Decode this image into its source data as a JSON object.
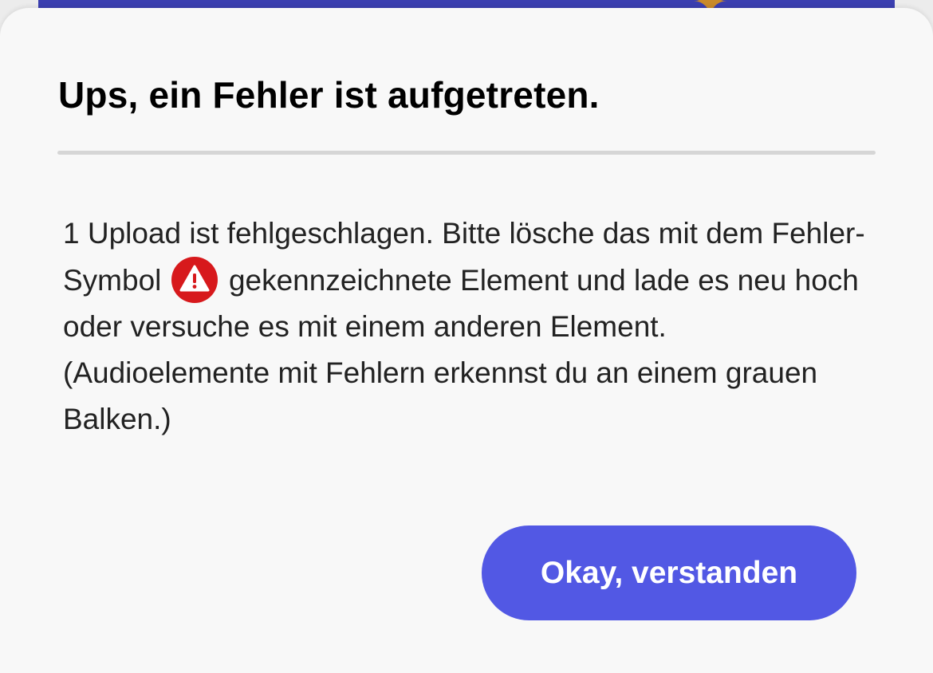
{
  "dialog": {
    "title": "Ups, ein Fehler ist aufgetreten.",
    "message_part1": "1 Upload ist fehlgeschlagen. Bitte lösche das mit dem Fehler-Symbol",
    "message_icon": "warning-triangle-icon",
    "message_part2": "gekennzeichnete Element und lade es neu hoch oder versuche es mit einem anderen Element. (Audioelemente mit Fehlern erkennst du an einem grauen Balken.)",
    "confirm_button": "Okay, verstanden"
  },
  "colors": {
    "accent": "#5258e4",
    "error": "#d7191c",
    "background": "#f8f8f8",
    "divider": "#d6d6d6"
  }
}
